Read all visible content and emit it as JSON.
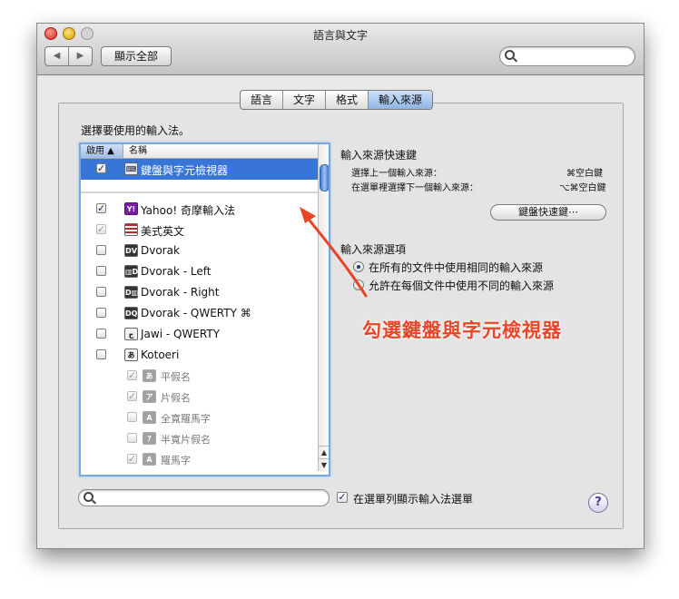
{
  "window": {
    "title": "語言與文字"
  },
  "toolbar": {
    "back_icon": "◀",
    "forward_icon": "▶",
    "show_all": "顯示全部",
    "search_placeholder": ""
  },
  "tabs": [
    {
      "label": "語言",
      "active": false
    },
    {
      "label": "文字",
      "active": false
    },
    {
      "label": "格式",
      "active": false
    },
    {
      "label": "輸入來源",
      "active": true
    }
  ],
  "left": {
    "heading": "選擇要使用的輸入法。",
    "col_enable": "啟用 ▲",
    "col_name": "名稱",
    "rows": [
      {
        "checked": true,
        "icon": "⌨",
        "label": "鍵盤與字元檢視器",
        "selected": true
      },
      {
        "checked": true,
        "icon": "Y!",
        "label": "Yahoo! 奇摩輸入法"
      },
      {
        "checked": true,
        "icon": "🇺🇸",
        "label": "美式英文"
      },
      {
        "checked": false,
        "icon": "DV",
        "label": "Dvorak"
      },
      {
        "checked": false,
        "icon": "▥D",
        "label": "Dvorak - Left"
      },
      {
        "checked": false,
        "icon": "D▥",
        "label": "Dvorak - Right"
      },
      {
        "checked": false,
        "icon": "DQ",
        "label": "Dvorak - QWERTY ⌘"
      },
      {
        "checked": false,
        "icon": "ج",
        "label": "Jawi - QWERTY"
      },
      {
        "checked": false,
        "icon": "あ",
        "label": "Kotoeri"
      },
      {
        "checked": true,
        "icon": "あ",
        "label": "平假名"
      },
      {
        "checked": true,
        "icon": "ア",
        "label": "片假名"
      },
      {
        "checked": false,
        "icon": "A",
        "label": "全寬羅馬字"
      },
      {
        "checked": false,
        "icon": "ｱ",
        "label": "半寬片假名"
      },
      {
        "checked": true,
        "icon": "A",
        "label": "羅馬字"
      }
    ],
    "search_placeholder": "",
    "show_menu_label": "在選單列顯示輸入法選單"
  },
  "right": {
    "shortcuts_heading": "輸入來源快速鍵",
    "prev_label": "選擇上一個輸入來源：",
    "prev_key": "⌘空白鍵",
    "next_label": "在選單裡選擇下一個輸入來源：",
    "next_key": "⌥⌘空白鍵",
    "kbd_button": "鍵盤快速鍵⋯",
    "options_heading": "輸入來源選項",
    "option1": "在所有的文件中使用相同的輸入來源",
    "option2": "允許在每個文件中使用不同的輸入來源"
  },
  "annotation": "勾選鍵盤與字元檢視器",
  "help": "?",
  "colors": {
    "selection": "#3875d7",
    "annotation": "#e84426",
    "tab_active": "#8fb5e4"
  }
}
